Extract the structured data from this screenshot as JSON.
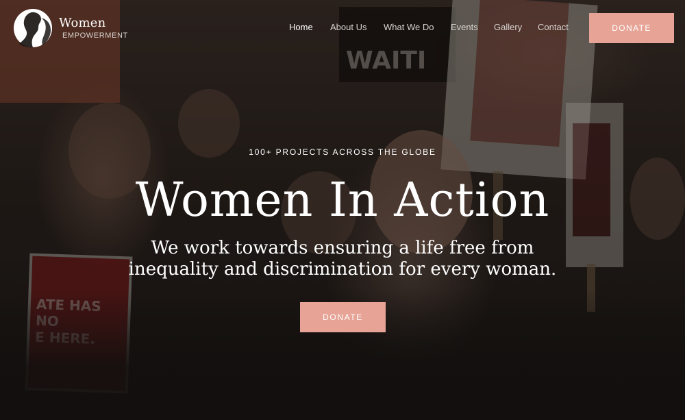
{
  "brand": {
    "title": "Women",
    "subtitle": "EMPOWERMENT"
  },
  "nav": {
    "items": [
      {
        "label": "Home",
        "active": true
      },
      {
        "label": "About Us",
        "active": false
      },
      {
        "label": "What We Do",
        "active": false
      },
      {
        "label": "Events",
        "active": false
      },
      {
        "label": "Gallery",
        "active": false
      },
      {
        "label": "Contact",
        "active": false
      }
    ],
    "donate_label": "DONATE"
  },
  "hero": {
    "kicker": "100+ PROJECTS ACROSS THE GLOBE",
    "title": "Women In Action",
    "subtitle": "We work towards ensuring a life free from inequality and discrimination for every woman.",
    "cta_label": "DONATE"
  },
  "colors": {
    "accent": "#e6a396",
    "text": "#ffffff",
    "overlay": "#1a1614"
  }
}
